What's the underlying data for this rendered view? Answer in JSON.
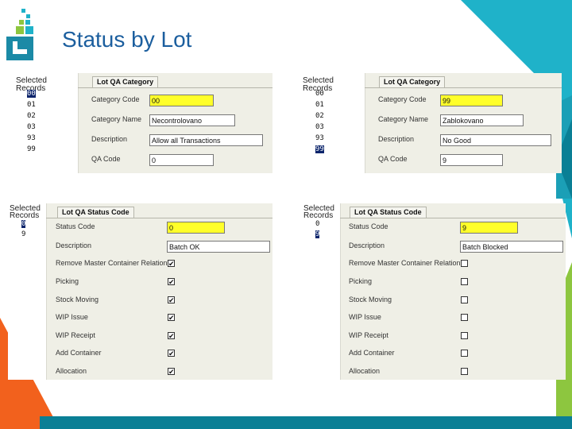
{
  "slide": {
    "title": "Status by Lot",
    "colors": {
      "teal": "#1fb2c9",
      "dark_teal": "#0a7f95",
      "orange": "#f2611d",
      "green": "#8dc63f",
      "title": "#1b5e9e"
    }
  },
  "panels": [
    {
      "list_header": "Selected Records",
      "records": [
        "00",
        "01",
        "02",
        "03",
        "93",
        "99"
      ],
      "selected": "00",
      "tab": "Lot QA Category",
      "fields": [
        {
          "label": "Category Code",
          "value": "00",
          "highlight": true
        },
        {
          "label": "Category Name",
          "value": "Necontrolovano",
          "highlight": false
        },
        {
          "label": "Description",
          "value": "Allow all Transactions",
          "highlight": false
        },
        {
          "label": "QA Code",
          "value": "0",
          "highlight": false
        }
      ]
    },
    {
      "list_header": "Selected Records",
      "records": [
        "00",
        "01",
        "02",
        "03",
        "93",
        "99"
      ],
      "selected": "99",
      "tab": "Lot QA Category",
      "fields": [
        {
          "label": "Category Code",
          "value": "99",
          "highlight": true
        },
        {
          "label": "Category Name",
          "value": "Zablokovano",
          "highlight": false
        },
        {
          "label": "Description",
          "value": "No Good",
          "highlight": false
        },
        {
          "label": "QA Code",
          "value": "9",
          "highlight": false
        }
      ]
    },
    {
      "list_header_1": "Selected",
      "list_header_2": "Records",
      "records": [
        "0",
        "9"
      ],
      "selected": "0",
      "tab": "Lot QA Status Code",
      "fields": [
        {
          "label": "Status Code",
          "value": "0",
          "highlight": true
        },
        {
          "label": "Description",
          "value": "Batch OK",
          "highlight": false
        }
      ],
      "checks": [
        {
          "label": "Remove Master Container Relation",
          "checked": true
        },
        {
          "label": "Picking",
          "checked": true
        },
        {
          "label": "Stock Moving",
          "checked": true
        },
        {
          "label": "WIP Issue",
          "checked": true
        },
        {
          "label": "WIP Receipt",
          "checked": true
        },
        {
          "label": "Add Container",
          "checked": true
        },
        {
          "label": "Allocation",
          "checked": true
        }
      ]
    },
    {
      "list_header_1": "Selected",
      "list_header_2": "Records",
      "records": [
        "0",
        "9"
      ],
      "selected": "9",
      "tab": "Lot QA Status Code",
      "fields": [
        {
          "label": "Status Code",
          "value": "9",
          "highlight": true
        },
        {
          "label": "Description",
          "value": "Batch Blocked",
          "highlight": false
        }
      ],
      "checks": [
        {
          "label": "Remove Master Container Relation",
          "checked": false
        },
        {
          "label": "Picking",
          "checked": false
        },
        {
          "label": "Stock Moving",
          "checked": false
        },
        {
          "label": "WIP Issue",
          "checked": false
        },
        {
          "label": "WIP Receipt",
          "checked": false
        },
        {
          "label": "Add Container",
          "checked": false
        },
        {
          "label": "Allocation",
          "checked": false
        }
      ]
    }
  ]
}
